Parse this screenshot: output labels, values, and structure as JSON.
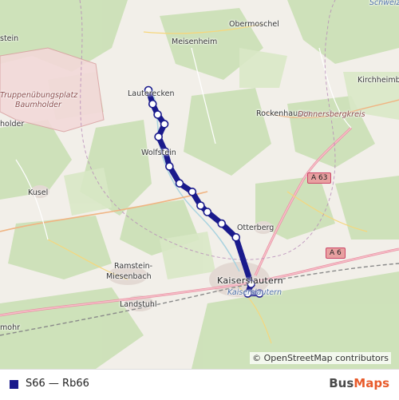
{
  "map": {
    "places": [
      {
        "id": "schweiz",
        "text": "Schweiz",
        "kind": "blue"
      },
      {
        "id": "obermoschel",
        "text": "Obermoschel",
        "kind": "town"
      },
      {
        "id": "meisenheim",
        "text": "Meisenheim",
        "kind": "town"
      },
      {
        "id": "stein",
        "text": "stein",
        "kind": "town"
      },
      {
        "id": "truppen1",
        "text": "Truppenübungsplatz",
        "kind": "italic"
      },
      {
        "id": "truppen2",
        "text": "Baumholder",
        "kind": "italic"
      },
      {
        "id": "lauterecken",
        "text": "Lauterecken",
        "kind": "town"
      },
      {
        "id": "kirchheimb",
        "text": "Kirchheimb",
        "kind": "town"
      },
      {
        "id": "rockenhausen",
        "text": "Rockenhausen",
        "kind": "town"
      },
      {
        "id": "donnersberg",
        "text": "Donnersbergkreis",
        "kind": "italic"
      },
      {
        "id": "holder",
        "text": "holder",
        "kind": "town"
      },
      {
        "id": "wolfstein",
        "text": "Wolfstein",
        "kind": "town"
      },
      {
        "id": "kusel",
        "text": "Kusel",
        "kind": "town"
      },
      {
        "id": "otterberg",
        "text": "Otterberg",
        "kind": "town"
      },
      {
        "id": "ramstein",
        "text": "Ramstein-",
        "kind": "town"
      },
      {
        "id": "miesenbach",
        "text": "Miesenbach",
        "kind": "town"
      },
      {
        "id": "kaiserslautern",
        "text": "Kaiserslautern",
        "kind": "city"
      },
      {
        "id": "kaiserslautern2",
        "text": "Kaiserslautern",
        "kind": "blue"
      },
      {
        "id": "landstuhl",
        "text": "Landstuhl",
        "kind": "town"
      },
      {
        "id": "mohr",
        "text": "mohr",
        "kind": "town"
      }
    ],
    "roads": [
      {
        "id": "a63",
        "text": "A 63"
      },
      {
        "id": "a6",
        "text": "A 6"
      }
    ],
    "attribution": "© OpenStreetMap contributors"
  },
  "route": {
    "line_color": "#1a1a8c",
    "stop_fill": "#ffffff",
    "stops": [
      {
        "lon": 7.598,
        "lat": 49.653
      },
      {
        "lon": 7.603,
        "lat": 49.64
      },
      {
        "lon": 7.609,
        "lat": 49.63
      },
      {
        "lon": 7.617,
        "lat": 49.621
      },
      {
        "lon": 7.61,
        "lat": 49.609
      },
      {
        "lon": 7.618,
        "lat": 49.595
      },
      {
        "lon": 7.623,
        "lat": 49.581
      },
      {
        "lon": 7.635,
        "lat": 49.565
      },
      {
        "lon": 7.65,
        "lat": 49.557
      },
      {
        "lon": 7.66,
        "lat": 49.544
      },
      {
        "lon": 7.668,
        "lat": 49.538
      },
      {
        "lon": 7.685,
        "lat": 49.527
      },
      {
        "lon": 7.702,
        "lat": 49.514
      },
      {
        "lon": 7.72,
        "lat": 49.47
      },
      {
        "lon": 7.716,
        "lat": 49.461
      },
      {
        "lon": 7.73,
        "lat": 49.461
      }
    ]
  },
  "legend": {
    "swatch_color": "#1a1a8c",
    "label": "S66 — Rb66",
    "brand_part1": "Bus",
    "brand_part2": "Maps"
  }
}
